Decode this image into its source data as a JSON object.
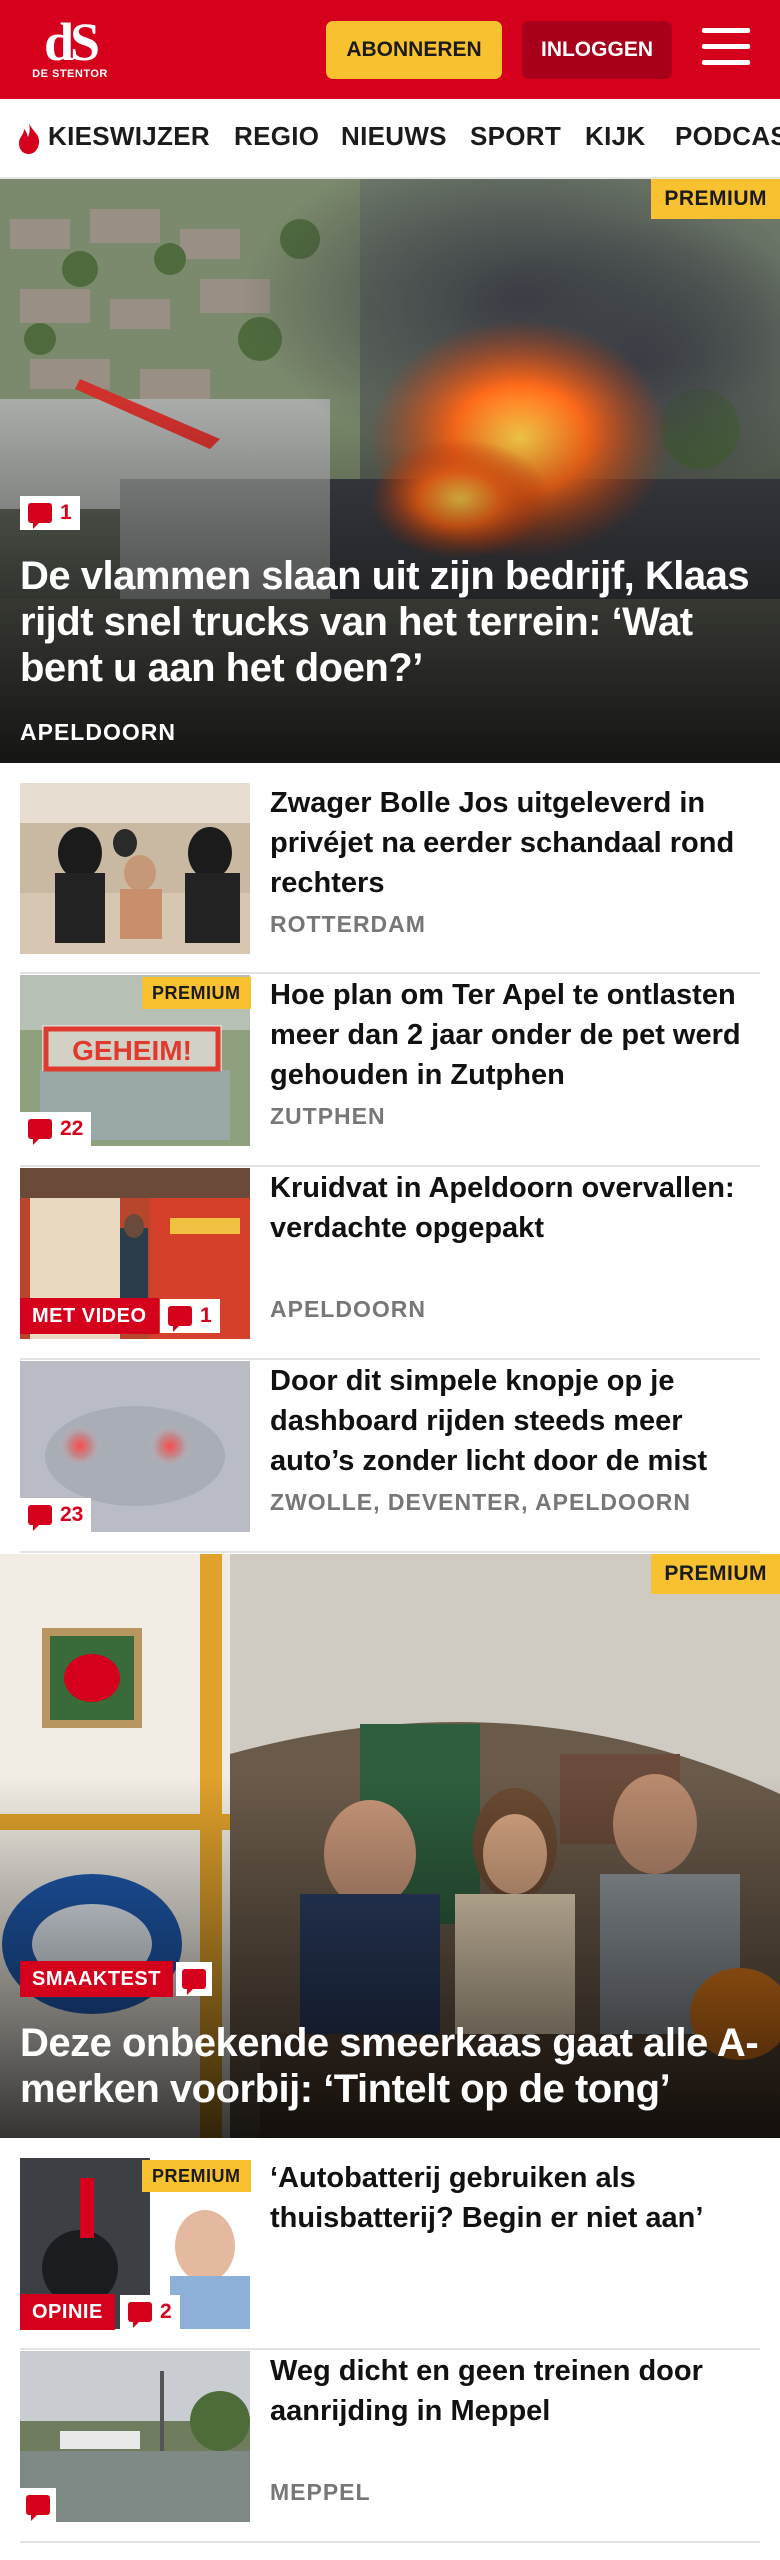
{
  "header": {
    "logo_mark": "dS",
    "logo_sub": "DE STENTOR",
    "subscribe_label": "ABONNEREN",
    "login_label": "INLOGGEN"
  },
  "nav": {
    "items": [
      "KIESWIJZER",
      "REGIO",
      "NIEUWS",
      "SPORT",
      "KIJK",
      "PODCAST"
    ]
  },
  "colors": {
    "brand": "#d5001c",
    "premium": "#f7c12f",
    "login_button": "#a8001a"
  },
  "hero1": {
    "badge": "PREMIUM",
    "comments": "1",
    "title": "De vlammen slaan uit zijn bedrijf, Klaas rijdt snel trucks van het terrein: ‘Wat bent u aan het doen?’",
    "location": "APELDOORN"
  },
  "articles": [
    {
      "title": "Zwager Bolle Jos uitgeleverd in privéjet na eerder schandaal rond rechters",
      "location": "ROTTERDAM"
    },
    {
      "badge": "PREMIUM",
      "overlay_text": "GEHEIM!",
      "comments": "22",
      "title": "Hoe plan om Ter Apel te ontlasten meer dan 2 jaar onder de pet werd gehouden in Zutphen",
      "location": "ZUTPHEN"
    },
    {
      "tag": "MET VIDEO",
      "comments": "1",
      "title": "Kruidvat in Apeldoorn overvallen: verdachte opgepakt",
      "location": "APELDOORN"
    },
    {
      "comments": "23",
      "title": "Door dit simpele knopje op je dashboard rijden steeds meer auto’s zonder licht door de mist",
      "location": "ZWOLLE, DEVENTER, APELDOORN"
    }
  ],
  "hero2": {
    "badge": "PREMIUM",
    "tag": "SMAAKTEST",
    "title": "Deze onbekende smeerkaas gaat alle A-merken voorbij: ‘Tintelt op de tong’"
  },
  "articles2": [
    {
      "badge": "PREMIUM",
      "tag": "OPINIE",
      "comments": "2",
      "title": "‘Autobatterij gebruiken als thuisbatterij? Begin er niet aan’"
    },
    {
      "title": "Weg dicht en geen treinen door aanrijding in Meppel",
      "location": "MEPPEL"
    }
  ],
  "icons": [
    "flame-icon",
    "menu-icon",
    "comment-icon"
  ]
}
